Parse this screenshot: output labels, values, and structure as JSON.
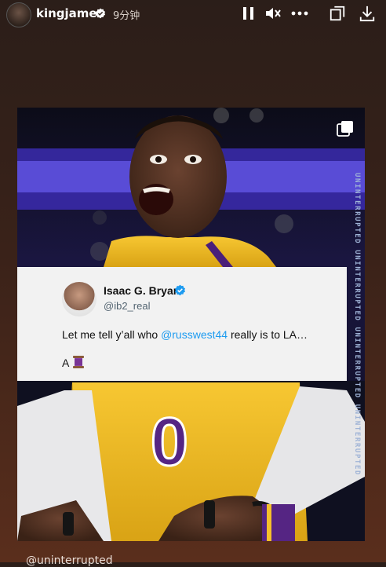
{
  "header": {
    "username": "kingjames",
    "timestamp": "9分钟",
    "icons": [
      "avatar",
      "verified-icon",
      "pause-icon",
      "mute-icon",
      "more-icon",
      "copy-icon",
      "download-icon"
    ]
  },
  "post": {
    "tweet": {
      "name": "Isaac G. Bryan",
      "handle": "@ib2_real",
      "text_before": "Let me tell y’all who ",
      "mention": "@russwest44",
      "text_after": " really is to LA…",
      "line2": "A"
    },
    "jersey_number": "0",
    "side_brand": "UNINTERRUPTED UNINTERRUPTED UNINTERRUPTED UNINTERRUPTED",
    "multi_icon": "multi-image-icon"
  },
  "caption": {
    "handle": "@uninterrupted"
  },
  "colors": {
    "lakers_gold": "#f5c12b",
    "lakers_purple": "#552583",
    "mention_blue": "#1d9bf0"
  }
}
